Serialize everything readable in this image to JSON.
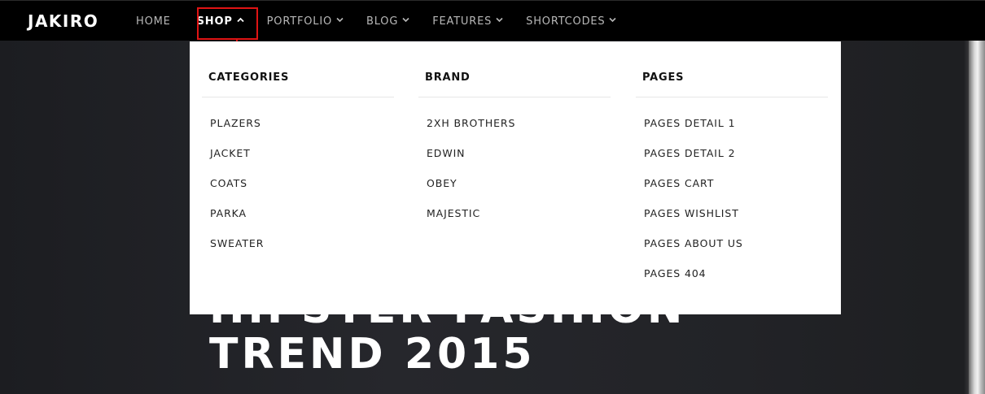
{
  "brand": {
    "logo": "JAKIRO"
  },
  "nav": {
    "items": [
      {
        "label": "HOME",
        "has_chevron": false,
        "active": false
      },
      {
        "label": "SHOP",
        "has_chevron": true,
        "chevron": "chevron-up-icon",
        "active": true
      },
      {
        "label": "PORTFOLIO",
        "has_chevron": true,
        "chevron": "chevron-down-icon",
        "active": false
      },
      {
        "label": "BLOG",
        "has_chevron": true,
        "chevron": "chevron-down-icon",
        "active": false
      },
      {
        "label": "FEATURES",
        "has_chevron": true,
        "chevron": "chevron-down-icon",
        "active": false
      },
      {
        "label": "SHORTCODES",
        "has_chevron": true,
        "chevron": "chevron-down-icon",
        "active": false
      }
    ]
  },
  "mega_menu": {
    "columns": [
      {
        "title": "CATEGORIES",
        "items": [
          "PLAZERS",
          "JACKET",
          "COATS",
          "PARKA",
          "SWEATER"
        ]
      },
      {
        "title": "BRAND",
        "items": [
          "2XH BROTHERS",
          "EDWIN",
          "OBEY",
          "MAJESTIC"
        ]
      },
      {
        "title": "PAGES",
        "items": [
          "PAGES DETAIL 1",
          "PAGES DETAIL 2",
          "PAGES CART",
          "PAGES WISHLIST",
          "PAGES ABOUT US",
          "PAGES 404"
        ]
      }
    ]
  },
  "hero": {
    "title_line1": "HIPSTER FASHION",
    "title_line2": "TREND 2015"
  },
  "colors": {
    "topbar": "#000000",
    "highlight_box": "#e01414",
    "menu_bg": "#ffffff",
    "hero_bg": "#232428"
  },
  "icons": {
    "up": "chevron-up-icon",
    "down": "chevron-down-icon",
    "annotation": "red-arrow-icon"
  }
}
